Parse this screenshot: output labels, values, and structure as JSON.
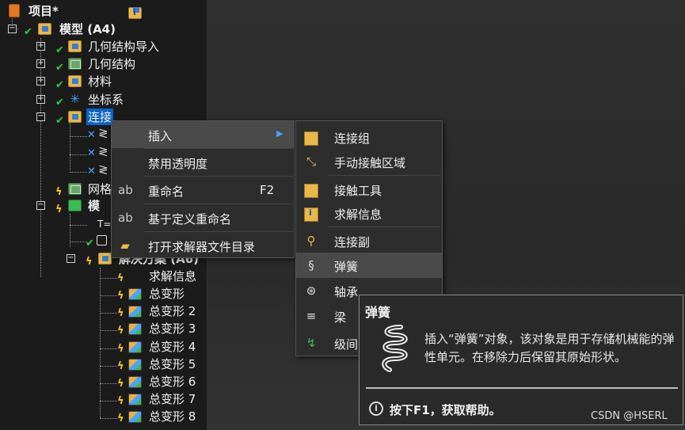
{
  "tree": {
    "root": {
      "label": "项目*"
    },
    "model": {
      "label": "模型 (A4)"
    },
    "items": [
      {
        "label": "几何结构导入"
      },
      {
        "label": "几何结构"
      },
      {
        "label": "材料"
      },
      {
        "label": "坐标系"
      },
      {
        "label": "连接"
      }
    ],
    "mesh_partial": "网格",
    "modal_partial": "模",
    "t_partial": "T=",
    "solution": {
      "label": "解决方案 (A6)"
    },
    "solution_children": [
      {
        "label": "求解信息"
      },
      {
        "label": "总变形"
      },
      {
        "label": "总变形 2"
      },
      {
        "label": "总变形 3"
      },
      {
        "label": "总变形 4"
      },
      {
        "label": "总变形 5"
      },
      {
        "label": "总变形 6"
      },
      {
        "label": "总变形 7"
      },
      {
        "label": "总变形 8"
      }
    ]
  },
  "context_menu": {
    "items": [
      {
        "label": "插入",
        "shortcut": ""
      },
      {
        "label": "禁用透明度",
        "shortcut": ""
      },
      {
        "label": "重命名",
        "shortcut": "F2"
      },
      {
        "label": "基于定义重命名",
        "shortcut": ""
      },
      {
        "label": "打开求解器文件目录",
        "shortcut": ""
      }
    ]
  },
  "submenu": {
    "items": [
      {
        "label": "连接组"
      },
      {
        "label": "手动接触区域"
      },
      {
        "label": "接触工具"
      },
      {
        "label": "求解信息"
      },
      {
        "label": "连接副"
      },
      {
        "label": "弹簧"
      },
      {
        "label": "轴承"
      },
      {
        "label": "梁"
      },
      {
        "label": "级间"
      }
    ]
  },
  "tooltip": {
    "title": "弹簧",
    "body": "插入“弹簧”对象，该对象是用于存储机械能的弹性单元。在移除力后保留其原始形状。",
    "help": "按下F1，获取帮助。"
  },
  "watermark": "CSDN @HSERL",
  "colors": {
    "selection": "#0a64c8",
    "check": "#2ecc40",
    "bolt": "#f5c518",
    "menu_bg": "#2d2d2d"
  }
}
